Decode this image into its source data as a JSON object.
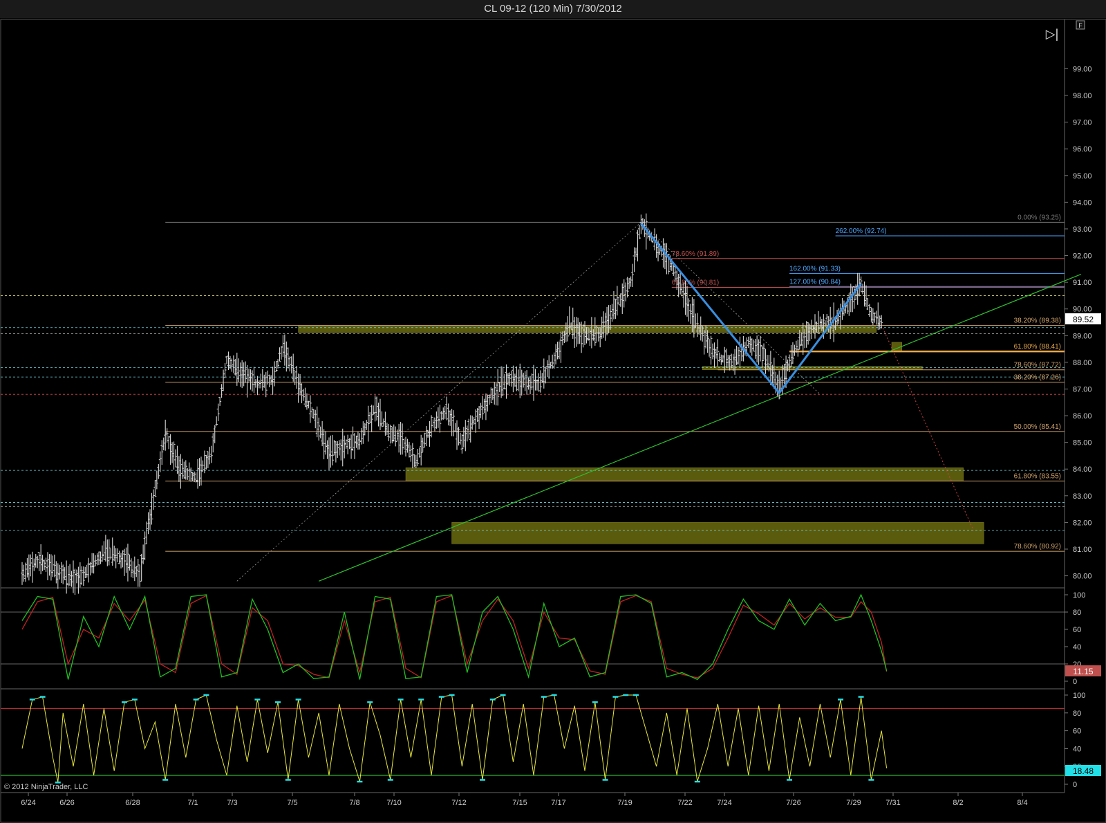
{
  "window": {
    "title": "CL 09-12 (120 Min)  7/30/2012"
  },
  "toolbar": {
    "collapse_glyph": "▷|",
    "f_label": "F"
  },
  "copyright": "© 2012 NinjaTrader, LLC",
  "colors": {
    "bar": "#d8d8d8",
    "pattern": "#3a8fe0",
    "trend": "#2fbf2f",
    "zone": "#6b6b10",
    "fib_tan": "#d2a36a",
    "fib_red": "#c0504d",
    "fib_blue": "#4aa6ff",
    "stoch_k": "#21c021",
    "stoch_d": "#c02121",
    "osc": "#e8e83a",
    "osc_hi": "#22e0e8"
  },
  "chart_data": [
    {
      "type": "candlestick",
      "title": "CL 09-12 (120 Min)  7/30/2012",
      "ylim": [
        79.6,
        100.8
      ],
      "y_ticks": [
        "99.00",
        "98.00",
        "97.00",
        "96.00",
        "95.00",
        "94.00",
        "93.00",
        "92.00",
        "91.00",
        "90.00",
        "89.00",
        "88.00",
        "87.00",
        "86.00",
        "85.00",
        "84.00",
        "83.00",
        "82.00",
        "81.00",
        "80.00"
      ],
      "x_ticks": [
        "6/24",
        "6/26",
        "6/28",
        "7/1",
        "7/3",
        "7/5",
        "7/8",
        "7/10",
        "7/12",
        "7/15",
        "7/17",
        "7/19",
        "7/22",
        "7/24",
        "7/26",
        "7/29",
        "7/31",
        "8/2",
        "8/4"
      ],
      "last_price": "89.52",
      "price_path": [
        [
          0,
          80.0
        ],
        [
          3,
          80.6
        ],
        [
          6,
          80.3
        ],
        [
          9,
          79.9
        ],
        [
          12,
          80.0
        ],
        [
          16,
          80.9
        ],
        [
          20,
          80.6
        ],
        [
          23,
          80.1
        ],
        [
          26,
          83.2
        ],
        [
          28,
          85.3
        ],
        [
          31,
          84.0
        ],
        [
          34,
          83.7
        ],
        [
          37,
          84.6
        ],
        [
          40,
          88.1
        ],
        [
          43,
          87.6
        ],
        [
          46,
          87.2
        ],
        [
          49,
          87.4
        ],
        [
          51,
          88.6
        ],
        [
          54,
          87.2
        ],
        [
          57,
          86.0
        ],
        [
          60,
          84.6
        ],
        [
          63,
          84.9
        ],
        [
          66,
          85.1
        ],
        [
          69,
          86.3
        ],
        [
          72,
          85.3
        ],
        [
          74,
          85.2
        ],
        [
          77,
          84.3
        ],
        [
          80,
          85.6
        ],
        [
          83,
          86.2
        ],
        [
          86,
          85.0
        ],
        [
          89,
          86.0
        ],
        [
          92,
          86.8
        ],
        [
          95,
          87.4
        ],
        [
          98,
          87.3
        ],
        [
          101,
          87.2
        ],
        [
          104,
          88.1
        ],
        [
          107,
          89.4
        ],
        [
          110,
          89.0
        ],
        [
          113,
          89.1
        ],
        [
          116,
          90.1
        ],
        [
          119,
          91.0
        ],
        [
          121,
          93.2
        ],
        [
          124,
          92.4
        ],
        [
          127,
          91.6
        ],
        [
          130,
          90.2
        ],
        [
          133,
          89.0
        ],
        [
          136,
          88.2
        ],
        [
          139,
          88.0
        ],
        [
          142,
          88.7
        ],
        [
          145,
          88.3
        ],
        [
          148,
          87.0
        ],
        [
          151,
          88.5
        ],
        [
          154,
          89.2
        ],
        [
          156,
          89.4
        ],
        [
          159,
          89.5
        ],
        [
          162,
          90.3
        ],
        [
          164,
          90.9
        ],
        [
          166,
          89.8
        ],
        [
          168,
          89.5
        ]
      ],
      "zones": [
        {
          "from_x": 54,
          "to_x": 167,
          "from_y": 89.12,
          "to_y": 89.38
        },
        {
          "from_x": 75,
          "to_x": 184,
          "from_y": 83.55,
          "to_y": 84.05
        },
        {
          "from_x": 84,
          "to_x": 188,
          "from_y": 81.2,
          "to_y": 82.0
        },
        {
          "from_x": 133,
          "to_x": 176,
          "from_y": 87.72,
          "to_y": 87.85
        },
        {
          "from_x": 170,
          "to_x": 172,
          "from_y": 88.43,
          "to_y": 88.75
        }
      ],
      "fib_levels": [
        {
          "label": "0.00% (93.25)",
          "y": 93.25,
          "from_x": 28,
          "style": "grey"
        },
        {
          "label": "262.00% (92.74)",
          "y": 92.74,
          "from_x": 159,
          "style": "blue"
        },
        {
          "label": "78.60% (91.89)",
          "y": 91.89,
          "from_x": 127,
          "style": "red"
        },
        {
          "label": "162.00% (91.33)",
          "y": 91.33,
          "from_x": 150,
          "style": "blue"
        },
        {
          "label": "127.00% (90.84)",
          "y": 90.84,
          "from_x": 150,
          "style": "blue"
        },
        {
          "label": "61.80% (90.81)",
          "y": 90.81,
          "from_x": 127,
          "style": "red"
        },
        {
          "label": "38.20% (89.38)",
          "y": 89.38,
          "from_x": 28,
          "style": "tan"
        },
        {
          "label": "61.80% (88.41)",
          "y": 88.41,
          "from_x": 150,
          "style": "gold"
        },
        {
          "label": "78.60% (87.72)",
          "y": 87.72,
          "from_x": 136,
          "style": "tan"
        },
        {
          "label": "38.20% (87.26)",
          "y": 87.26,
          "from_x": 28,
          "style": "tan"
        },
        {
          "label": "50.00% (85.41)",
          "y": 85.41,
          "from_x": 28,
          "style": "tan"
        },
        {
          "label": "61.80% (83.55)",
          "y": 83.55,
          "from_x": 28,
          "style": "tan"
        },
        {
          "label": "78.60% (80.92)",
          "y": 80.92,
          "from_x": 28,
          "style": "tan"
        }
      ],
      "horizontal_lines": [
        {
          "y": 90.5,
          "style": "yellow-dash"
        },
        {
          "y": 89.3,
          "style": "cyan-dash"
        },
        {
          "y": 89.07,
          "style": "grey-dash"
        },
        {
          "y": 87.8,
          "style": "cyan-dash"
        },
        {
          "y": 87.45,
          "style": "cyan-dash"
        },
        {
          "y": 86.8,
          "style": "red-dash"
        },
        {
          "y": 83.95,
          "style": "cyan-dash"
        },
        {
          "y": 82.75,
          "style": "cyan-dash"
        },
        {
          "y": 82.6,
          "style": "grey-dash"
        },
        {
          "y": 81.7,
          "style": "cyan-dash"
        }
      ],
      "pattern": [
        [
          121,
          93.2
        ],
        [
          148,
          86.85
        ],
        [
          164,
          90.95
        ]
      ],
      "trendlines": [
        {
          "from": [
            58,
            79.8
          ],
          "to": [
            207,
            91.3
          ],
          "style": "green"
        },
        {
          "from": [
            42,
            79.8
          ],
          "to": [
            121,
            93.25
          ],
          "style": "grey-dot"
        },
        {
          "from": [
            121,
            93.25
          ],
          "to": [
            156,
            86.8
          ],
          "style": "grey-dot"
        },
        {
          "from": [
            168,
            89.4
          ],
          "to": [
            186,
            81.7
          ],
          "style": "red-dot"
        }
      ]
    },
    {
      "type": "line",
      "name": "stochastics",
      "ylim": [
        0,
        100
      ],
      "y_ticks": [
        "100",
        "80",
        "60",
        "40",
        "20",
        "0"
      ],
      "last_value": "11.15",
      "level_lines": [
        80,
        20
      ],
      "k_path": [
        [
          0,
          70
        ],
        [
          3,
          98
        ],
        [
          6,
          95
        ],
        [
          9,
          2
        ],
        [
          12,
          75
        ],
        [
          15,
          40
        ],
        [
          18,
          98
        ],
        [
          21,
          60
        ],
        [
          24,
          98
        ],
        [
          27,
          5
        ],
        [
          30,
          15
        ],
        [
          33,
          98
        ],
        [
          36,
          100
        ],
        [
          39,
          5
        ],
        [
          42,
          10
        ],
        [
          45,
          95
        ],
        [
          48,
          60
        ],
        [
          51,
          10
        ],
        [
          54,
          20
        ],
        [
          57,
          3
        ],
        [
          60,
          5
        ],
        [
          63,
          80
        ],
        [
          66,
          2
        ],
        [
          69,
          98
        ],
        [
          72,
          95
        ],
        [
          75,
          3
        ],
        [
          78,
          5
        ],
        [
          81,
          98
        ],
        [
          84,
          100
        ],
        [
          87,
          10
        ],
        [
          90,
          80
        ],
        [
          93,
          98
        ],
        [
          96,
          60
        ],
        [
          99,
          5
        ],
        [
          102,
          90
        ],
        [
          105,
          40
        ],
        [
          108,
          50
        ],
        [
          111,
          5
        ],
        [
          114,
          10
        ],
        [
          117,
          98
        ],
        [
          120,
          100
        ],
        [
          123,
          90
        ],
        [
          126,
          5
        ],
        [
          129,
          10
        ],
        [
          132,
          2
        ],
        [
          135,
          20
        ],
        [
          138,
          60
        ],
        [
          141,
          95
        ],
        [
          144,
          70
        ],
        [
          147,
          60
        ],
        [
          150,
          95
        ],
        [
          153,
          65
        ],
        [
          156,
          90
        ],
        [
          159,
          70
        ],
        [
          162,
          75
        ],
        [
          164,
          100
        ],
        [
          166,
          70
        ],
        [
          168,
          35
        ],
        [
          169,
          12
        ]
      ],
      "d_path": [
        [
          0,
          60
        ],
        [
          3,
          92
        ],
        [
          6,
          97
        ],
        [
          9,
          20
        ],
        [
          12,
          60
        ],
        [
          15,
          50
        ],
        [
          18,
          90
        ],
        [
          21,
          70
        ],
        [
          24,
          94
        ],
        [
          27,
          20
        ],
        [
          30,
          10
        ],
        [
          33,
          90
        ],
        [
          36,
          99
        ],
        [
          39,
          20
        ],
        [
          42,
          8
        ],
        [
          45,
          85
        ],
        [
          48,
          70
        ],
        [
          51,
          20
        ],
        [
          54,
          18
        ],
        [
          57,
          8
        ],
        [
          60,
          4
        ],
        [
          63,
          70
        ],
        [
          66,
          10
        ],
        [
          69,
          92
        ],
        [
          72,
          97
        ],
        [
          75,
          15
        ],
        [
          78,
          4
        ],
        [
          81,
          92
        ],
        [
          84,
          99
        ],
        [
          87,
          20
        ],
        [
          90,
          70
        ],
        [
          93,
          95
        ],
        [
          96,
          70
        ],
        [
          99,
          15
        ],
        [
          102,
          80
        ],
        [
          105,
          50
        ],
        [
          108,
          48
        ],
        [
          111,
          12
        ],
        [
          114,
          8
        ],
        [
          117,
          92
        ],
        [
          120,
          99
        ],
        [
          123,
          92
        ],
        [
          126,
          15
        ],
        [
          129,
          8
        ],
        [
          132,
          4
        ],
        [
          135,
          15
        ],
        [
          138,
          50
        ],
        [
          141,
          88
        ],
        [
          144,
          78
        ],
        [
          147,
          65
        ],
        [
          150,
          90
        ],
        [
          153,
          72
        ],
        [
          156,
          85
        ],
        [
          159,
          74
        ],
        [
          162,
          74
        ],
        [
          164,
          92
        ],
        [
          166,
          80
        ],
        [
          168,
          45
        ],
        [
          169,
          11
        ]
      ]
    },
    {
      "type": "line",
      "name": "oscillator",
      "ylim": [
        0,
        100
      ],
      "y_ticks": [
        "100",
        "80",
        "60",
        "40",
        "20",
        "0"
      ],
      "last_value": "18.48",
      "level_lines": [
        85,
        10
      ],
      "path": [
        [
          0,
          40
        ],
        [
          2,
          95
        ],
        [
          4,
          98
        ],
        [
          6,
          30
        ],
        [
          7,
          2
        ],
        [
          8,
          80
        ],
        [
          10,
          20
        ],
        [
          12,
          90
        ],
        [
          14,
          10
        ],
        [
          16,
          85
        ],
        [
          18,
          15
        ],
        [
          20,
          92
        ],
        [
          22,
          95
        ],
        [
          24,
          40
        ],
        [
          26,
          70
        ],
        [
          28,
          5
        ],
        [
          30,
          90
        ],
        [
          32,
          30
        ],
        [
          34,
          95
        ],
        [
          36,
          100
        ],
        [
          38,
          50
        ],
        [
          40,
          10
        ],
        [
          42,
          88
        ],
        [
          44,
          25
        ],
        [
          46,
          95
        ],
        [
          48,
          35
        ],
        [
          50,
          92
        ],
        [
          52,
          5
        ],
        [
          54,
          95
        ],
        [
          56,
          30
        ],
        [
          58,
          80
        ],
        [
          60,
          10
        ],
        [
          62,
          90
        ],
        [
          64,
          40
        ],
        [
          66,
          3
        ],
        [
          68,
          92
        ],
        [
          70,
          55
        ],
        [
          72,
          5
        ],
        [
          74,
          95
        ],
        [
          76,
          30
        ],
        [
          78,
          95
        ],
        [
          80,
          10
        ],
        [
          82,
          98
        ],
        [
          84,
          100
        ],
        [
          86,
          20
        ],
        [
          88,
          90
        ],
        [
          90,
          5
        ],
        [
          92,
          95
        ],
        [
          94,
          100
        ],
        [
          96,
          25
        ],
        [
          98,
          90
        ],
        [
          100,
          10
        ],
        [
          102,
          98
        ],
        [
          104,
          100
        ],
        [
          106,
          40
        ],
        [
          108,
          88
        ],
        [
          110,
          15
        ],
        [
          112,
          92
        ],
        [
          114,
          5
        ],
        [
          116,
          98
        ],
        [
          118,
          100
        ],
        [
          120,
          100
        ],
        [
          122,
          60
        ],
        [
          124,
          20
        ],
        [
          126,
          80
        ],
        [
          128,
          10
        ],
        [
          130,
          85
        ],
        [
          132,
          3
        ],
        [
          134,
          40
        ],
        [
          136,
          90
        ],
        [
          138,
          20
        ],
        [
          140,
          85
        ],
        [
          142,
          10
        ],
        [
          144,
          88
        ],
        [
          146,
          15
        ],
        [
          148,
          90
        ],
        [
          150,
          5
        ],
        [
          152,
          75
        ],
        [
          154,
          20
        ],
        [
          156,
          90
        ],
        [
          158,
          30
        ],
        [
          160,
          95
        ],
        [
          162,
          10
        ],
        [
          164,
          98
        ],
        [
          166,
          5
        ],
        [
          168,
          60
        ],
        [
          169,
          18
        ]
      ]
    }
  ]
}
